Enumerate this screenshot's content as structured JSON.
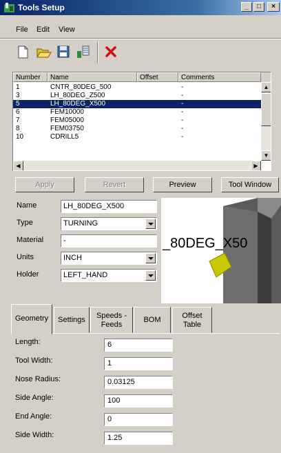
{
  "window": {
    "title": "Tools Setup",
    "minimize": "_",
    "maximize": "□",
    "close": "×"
  },
  "menu": [
    "File",
    "Edit",
    "View"
  ],
  "toolbar": [
    {
      "name": "new-file-icon"
    },
    {
      "name": "open-folder-icon"
    },
    {
      "name": "save-disk-icon"
    },
    {
      "name": "tool-library-icon"
    },
    {
      "name": "delete-x-icon"
    }
  ],
  "tool_list": {
    "columns": [
      "Number",
      "Name",
      "Offset",
      "Comments"
    ],
    "rows": [
      {
        "number": "1",
        "name": "CNTR_80DEG_500",
        "offset": "",
        "comments": "-"
      },
      {
        "number": "3",
        "name": "LH_80DEG_Z500",
        "offset": "",
        "comments": "-"
      },
      {
        "number": "5",
        "name": "LH_80DEG_X500",
        "offset": "",
        "comments": "-"
      },
      {
        "number": "6",
        "name": "FEM10000",
        "offset": "",
        "comments": "-"
      },
      {
        "number": "7",
        "name": "FEM05000",
        "offset": "",
        "comments": "-"
      },
      {
        "number": "8",
        "name": "FEM03750",
        "offset": "",
        "comments": "-"
      },
      {
        "number": "10",
        "name": "CDRILL5",
        "offset": "",
        "comments": "-"
      }
    ],
    "selected_index": 2
  },
  "buttons": {
    "apply": "Apply",
    "revert": "Revert",
    "preview": "Preview",
    "tool_window": "Tool Window"
  },
  "properties": {
    "name_label": "Name",
    "name_value": "LH_80DEG_X500",
    "type_label": "Type",
    "type_value": "TURNING",
    "material_label": "Material",
    "material_value": "-",
    "units_label": "Units",
    "units_value": "INCH",
    "holder_label": "Holder",
    "holder_value": "LEFT_HAND"
  },
  "preview": {
    "label": "_80DEG_X50",
    "insert_color": "#c8c800",
    "holder_color": "#6e6e6e"
  },
  "tabs": {
    "geometry": "Geometry",
    "settings": "Settings",
    "speeds": "Speeds - Feeds",
    "bom": "BOM",
    "offset": "Offset Table"
  },
  "geometry": {
    "length_label": "Length:",
    "length_value": "6",
    "tool_width_label": "Tool Width:",
    "tool_width_value": "1",
    "nose_radius_label": "Nose Radius:",
    "nose_radius_value": "0.03125",
    "side_angle_label": "Side Angle:",
    "side_angle_value": "100",
    "end_angle_label": "End Angle:",
    "end_angle_value": "0",
    "side_width_label": "Side Width:",
    "side_width_value": "1.25"
  }
}
